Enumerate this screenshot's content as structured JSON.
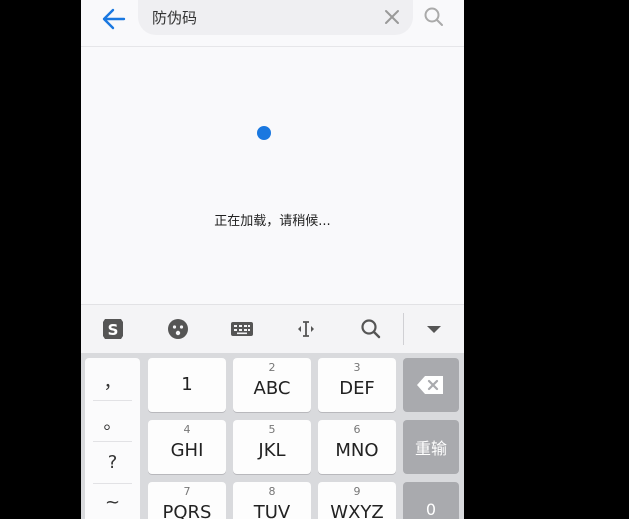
{
  "search": {
    "query": "防伪码"
  },
  "content": {
    "loading_text": "正在加载，请稍候..."
  },
  "colors": {
    "accent": "#1a78e0",
    "background": "#f9f9fb",
    "function_key": "#a9aaae"
  },
  "keyboard": {
    "toolbar": [
      "sogou-logo-icon",
      "emoji-icon",
      "keyboard-icon",
      "cursor-move-icon",
      "search-icon",
      "collapse-icon"
    ],
    "side_symbols": [
      "，",
      "。",
      "?",
      "~"
    ],
    "keys": [
      {
        "num": "",
        "label": "1"
      },
      {
        "num": "2",
        "label": "ABC"
      },
      {
        "num": "3",
        "label": "DEF"
      },
      {
        "num": "4",
        "label": "GHI"
      },
      {
        "num": "5",
        "label": "JKL"
      },
      {
        "num": "6",
        "label": "MNO"
      },
      {
        "num": "7",
        "label": "PQRS"
      },
      {
        "num": "8",
        "label": "TUV"
      },
      {
        "num": "9",
        "label": "WXYZ"
      }
    ],
    "reinput_label": "重输",
    "zero_label": "0"
  }
}
